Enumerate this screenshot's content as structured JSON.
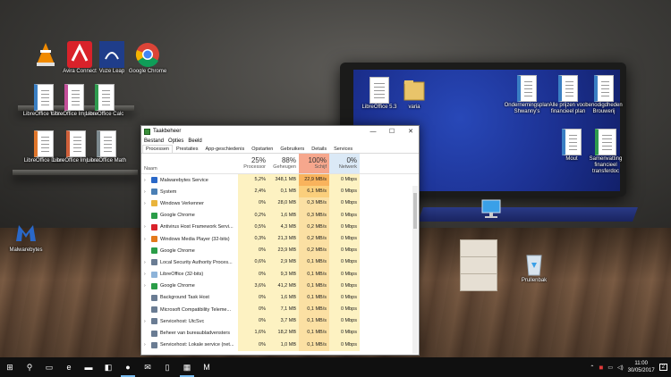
{
  "desktop": {
    "icons_left": [
      {
        "name": "vlc",
        "label": "",
        "icon": "vlc-cone-icon",
        "color": "#f08a00"
      },
      {
        "name": "avira",
        "label": "Avira Connect",
        "icon": "avira-umbrella-icon",
        "color": "#d9222a"
      },
      {
        "name": "vuze",
        "label": "Vuze Leap",
        "icon": "vuze-frog-icon",
        "color": "#1f3d8a"
      },
      {
        "name": "chrome",
        "label": "Google Chrome",
        "icon": "chrome-icon",
        "color": "#2a9d48"
      },
      {
        "name": "lo-writer-1",
        "label": "LibreOffice Writer",
        "icon": "writer-doc-icon",
        "color": "#3a7fc4"
      },
      {
        "name": "lo-impress-1",
        "label": "LibreOffice Impress",
        "icon": "impress-doc-icon",
        "color": "#c44f9a"
      },
      {
        "name": "lo-calc-1",
        "label": "LibreOffice Calc",
        "icon": "calc-doc-icon",
        "color": "#2e9b4e"
      },
      {
        "name": "lo-draw",
        "label": "LibreOffice Draw",
        "icon": "draw-doc-icon",
        "color": "#e0762b"
      },
      {
        "name": "lo-impress-2",
        "label": "LibreOffice Impress",
        "icon": "impress-doc-icon",
        "color": "#d0603a"
      },
      {
        "name": "lo-math",
        "label": "LibreOffice Math",
        "icon": "math-doc-icon",
        "color": "#7d8a8f"
      },
      {
        "name": "malwarebytes",
        "label": "Malwarebytes",
        "icon": "malwarebytes-icon",
        "color": "#2a68c8"
      }
    ],
    "icons_right": [
      {
        "name": "libreoffice",
        "label": "LibreOffice 5.3",
        "icon": "libreoffice-doc-icon"
      },
      {
        "name": "varia",
        "label": "varia",
        "icon": "folder-icon"
      },
      {
        "name": "ondernemingsplan",
        "label": "Ondernemingsplan Shwanny's",
        "icon": "writer-doc-icon"
      },
      {
        "name": "prijzen",
        "label": "Alle prijzen voor financieel plan",
        "icon": "writer-doc-icon"
      },
      {
        "name": "benodigdheden",
        "label": "benodigdheden Brouwerij",
        "icon": "writer-doc-icon"
      },
      {
        "name": "mout",
        "label": "Mout",
        "icon": "writer-doc-icon"
      },
      {
        "name": "samenvatting",
        "label": "Samenvatting financieel transferdoc",
        "icon": "calc-doc-icon"
      },
      {
        "name": "network",
        "label": "",
        "icon": "network-computer-icon"
      },
      {
        "name": "recycle",
        "label": "Prullenbak",
        "icon": "recycle-bin-icon"
      }
    ]
  },
  "taskmanager": {
    "title": "Taakbeheer",
    "controls": {
      "minimize": "—",
      "maximize": "☐",
      "close": "✕"
    },
    "menu": [
      "Bestand",
      "Opties",
      "Beeld"
    ],
    "tabs": [
      "Processen",
      "Prestaties",
      "App-geschiedenis",
      "Opstarten",
      "Gebruikers",
      "Details",
      "Services"
    ],
    "active_tab": 0,
    "columns": {
      "name": "Naam",
      "processor": {
        "pct": "25%",
        "label": "Processor"
      },
      "memory": {
        "pct": "88%",
        "label": "Geheugen"
      },
      "disk": {
        "pct": "100%",
        "label": "Schijf"
      },
      "network": {
        "pct": "0%",
        "label": "Netwerk"
      }
    },
    "rows": [
      {
        "expand": true,
        "name": "Malwarebytes Service",
        "cpu": "5,2%",
        "mem": "348,1 MB",
        "disk": "22,9 MB/s",
        "net": "0 Mbps",
        "icon": "malwarebytes-icon",
        "color": "#2a68c8"
      },
      {
        "expand": true,
        "name": "System",
        "cpu": "2,4%",
        "mem": "0,1 MB",
        "disk": "6,1 MB/s",
        "net": "0 Mbps",
        "icon": "system-icon",
        "color": "#4a7fb5"
      },
      {
        "expand": true,
        "name": "Windows Verkenner",
        "cpu": "0%",
        "mem": "28,0 MB",
        "disk": "0,3 MB/s",
        "net": "0 Mbps",
        "icon": "folder-icon",
        "color": "#e9b43c"
      },
      {
        "expand": false,
        "name": "Google Chrome",
        "cpu": "0,2%",
        "mem": "1,6 MB",
        "disk": "0,3 MB/s",
        "net": "0 Mbps",
        "icon": "chrome-icon",
        "color": "#2a9d48"
      },
      {
        "expand": true,
        "name": "Antivirus Host Framework Servi...",
        "cpu": "0,5%",
        "mem": "4,3 MB",
        "disk": "0,2 MB/s",
        "net": "0 Mbps",
        "icon": "avira-umbrella-icon",
        "color": "#d9222a"
      },
      {
        "expand": true,
        "name": "Windows Media Player (32-bits)",
        "cpu": "0,3%",
        "mem": "21,3 MB",
        "disk": "0,2 MB/s",
        "net": "0 Mbps",
        "icon": "media-player-icon",
        "color": "#e3791b"
      },
      {
        "expand": false,
        "name": "Google Chrome",
        "cpu": "0%",
        "mem": "23,9 MB",
        "disk": "0,2 MB/s",
        "net": "0 Mbps",
        "icon": "chrome-icon",
        "color": "#2a9d48"
      },
      {
        "expand": true,
        "name": "Local Security Authority Proces...",
        "cpu": "0,6%",
        "mem": "2,9 MB",
        "disk": "0,1 MB/s",
        "net": "0 Mbps",
        "icon": "service-icon",
        "color": "#6a7c93"
      },
      {
        "expand": true,
        "name": "LibreOffice (32-bits)",
        "cpu": "0%",
        "mem": "9,3 MB",
        "disk": "0,1 MB/s",
        "net": "0 Mbps",
        "icon": "libreoffice-doc-icon",
        "color": "#8db3d9"
      },
      {
        "expand": true,
        "name": "Google Chrome",
        "cpu": "3,6%",
        "mem": "41,2 MB",
        "disk": "0,1 MB/s",
        "net": "0 Mbps",
        "icon": "chrome-icon",
        "color": "#2a9d48"
      },
      {
        "expand": false,
        "name": "Background Task Host",
        "cpu": "0%",
        "mem": "1,6 MB",
        "disk": "0,1 MB/s",
        "net": "0 Mbps",
        "icon": "service-icon",
        "color": "#6a7c93"
      },
      {
        "expand": false,
        "name": "Microsoft Compatibility Teleme...",
        "cpu": "0%",
        "mem": "7,1 MB",
        "disk": "0,1 MB/s",
        "net": "0 Mbps",
        "icon": "service-icon",
        "color": "#6a7c93"
      },
      {
        "expand": true,
        "name": "Servicehost: UtcSvc",
        "cpu": "0%",
        "mem": "3,7 MB",
        "disk": "0,1 MB/s",
        "net": "0 Mbps",
        "icon": "gear-icon",
        "color": "#6a7c93"
      },
      {
        "expand": false,
        "name": "Beheer van bureaubladvensters",
        "cpu": "1,6%",
        "mem": "18,2 MB",
        "disk": "0,1 MB/s",
        "net": "0 Mbps",
        "icon": "service-icon",
        "color": "#6a7c93"
      },
      {
        "expand": true,
        "name": "Servicehost: Lokale service (net...",
        "cpu": "0%",
        "mem": "1,0 MB",
        "disk": "0,1 MB/s",
        "net": "0 Mbps",
        "icon": "gear-icon",
        "color": "#6a7c93"
      }
    ]
  },
  "taskbar": {
    "items": [
      {
        "name": "start",
        "glyph": "⊞",
        "icon": "windows-start-icon",
        "active": false
      },
      {
        "name": "search",
        "glyph": "⚲",
        "icon": "search-icon",
        "active": false
      },
      {
        "name": "task-view",
        "glyph": "▭",
        "icon": "task-view-icon",
        "active": false
      },
      {
        "name": "edge",
        "glyph": "e",
        "icon": "edge-icon",
        "active": false
      },
      {
        "name": "explorer",
        "glyph": "▬",
        "icon": "folder-icon",
        "active": false
      },
      {
        "name": "store",
        "glyph": "◧",
        "icon": "store-icon",
        "active": false
      },
      {
        "name": "chrome",
        "glyph": "●",
        "icon": "chrome-icon",
        "active": true
      },
      {
        "name": "mail",
        "glyph": "✉",
        "icon": "mail-icon",
        "active": false
      },
      {
        "name": "libreoffice",
        "glyph": "▯",
        "icon": "libreoffice-doc-icon",
        "active": false
      },
      {
        "name": "taskmanager",
        "glyph": "▦",
        "icon": "task-manager-icon",
        "active": true
      },
      {
        "name": "malwarebytes",
        "glyph": "M",
        "icon": "malwarebytes-icon",
        "active": false
      }
    ],
    "tray": {
      "time": "11:00",
      "date": "30/05/2017",
      "notifications": "2"
    }
  }
}
